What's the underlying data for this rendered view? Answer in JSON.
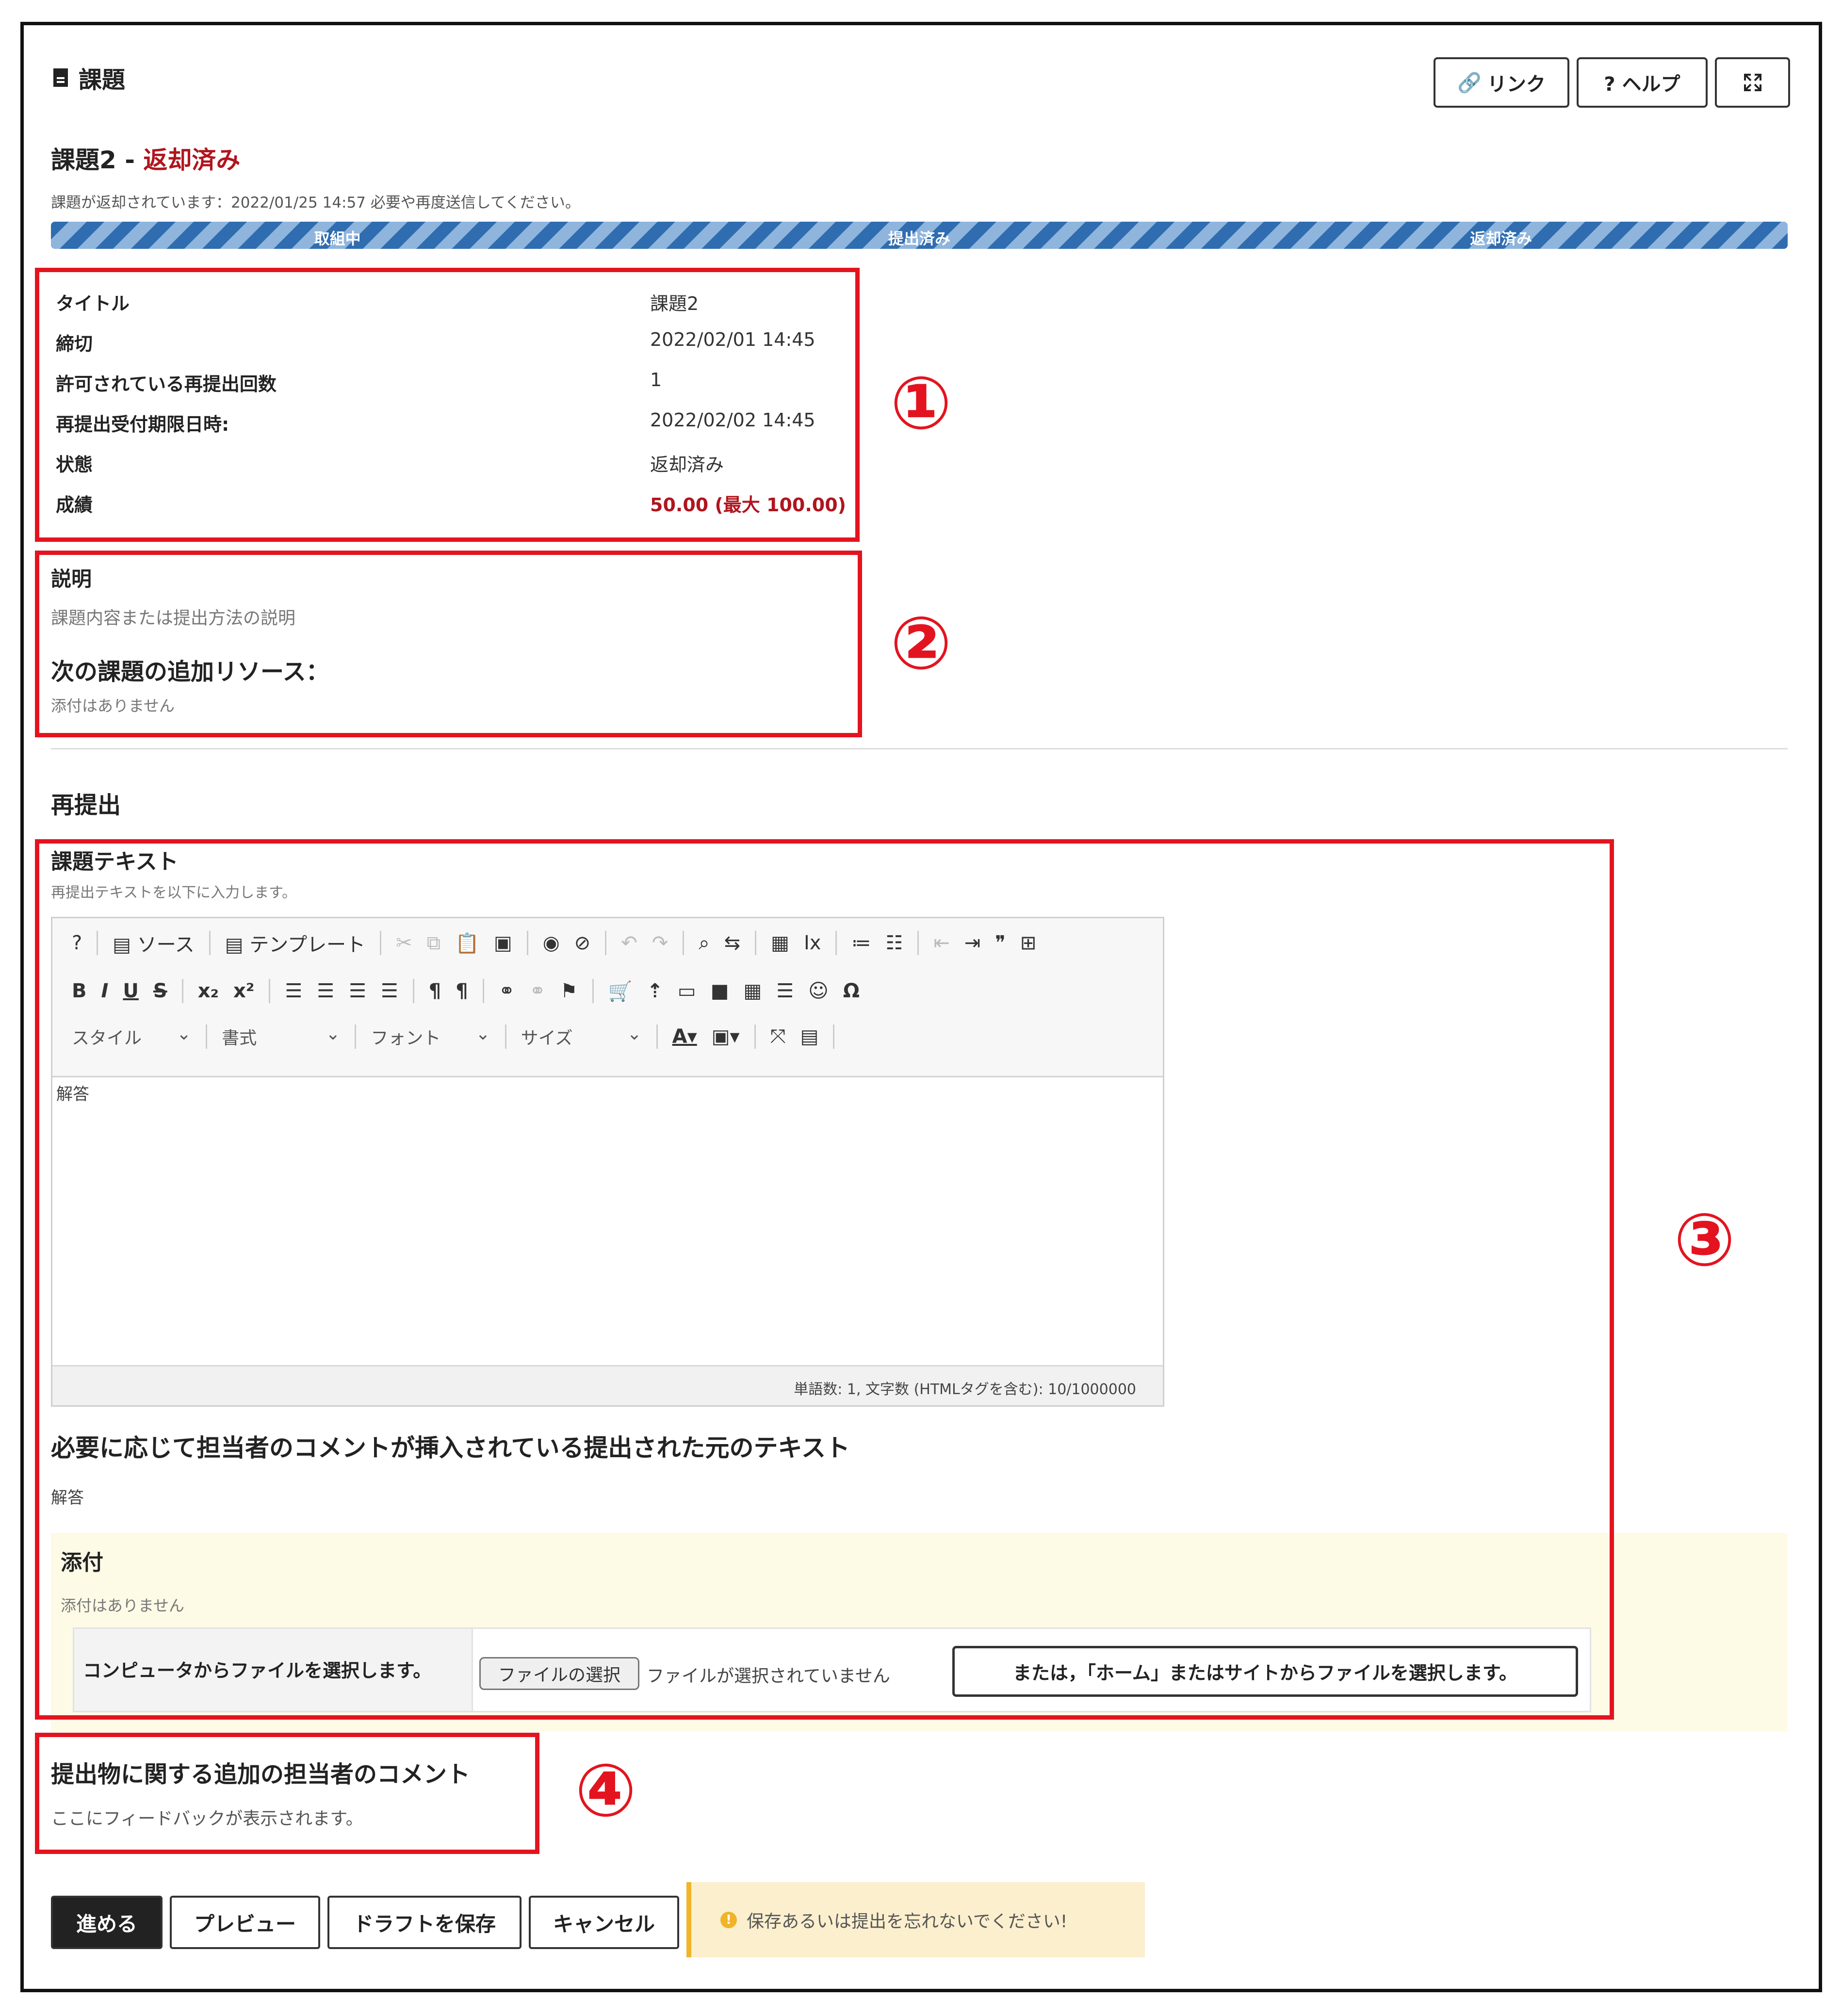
{
  "header": {
    "title": "課題",
    "link_button": "リンク",
    "help_button": "? ヘルプ",
    "fullscreen_icon": "expand-icon"
  },
  "assignment": {
    "name": "課題2",
    "separator": " - ",
    "status_heading": "返却済み",
    "return_notice": "課題が返却されています：2022/01/25 14:57 必要や再度送信してください。",
    "progress_steps": [
      "取組中",
      "提出済み",
      "返却済み"
    ]
  },
  "details": {
    "rows": [
      {
        "label": "タイトル",
        "value": "課題2"
      },
      {
        "label": "締切",
        "value": "2022/02/01 14:45"
      },
      {
        "label": "許可されている再提出回数",
        "value": "1"
      },
      {
        "label": "再提出受付期限日時:",
        "value": "2022/02/02 14:45"
      },
      {
        "label": "状態",
        "value": "返却済み"
      },
      {
        "label": "成績",
        "value": "50.00 (最大 100.00)"
      }
    ]
  },
  "description": {
    "heading": "説明",
    "text": "課題内容または提出方法の説明",
    "resources_heading": "次の課題の追加リソース：",
    "no_attachments": "添付はありません"
  },
  "resubmit": {
    "heading": "再提出",
    "text_heading": "課題テキスト",
    "text_hint": "再提出テキストを以下に入力します。",
    "editor": {
      "source_label": "ソース",
      "template_label": "テンプレート",
      "style_label": "スタイル",
      "format_label": "書式",
      "font_label": "フォント",
      "size_label": "サイズ",
      "content": "解答",
      "status": "単語数: 1, 文字数 (HTMLタグを含む): 10/1000000"
    },
    "original_heading": "必要に応じて担当者のコメントが挿入されている提出された元のテキスト",
    "original_text": "解答",
    "attach_heading": "添付",
    "attach_none": "添付はありません",
    "file_row_label": "コンピュータからファイルを選択します。",
    "file_choose_button": "ファイルの選択",
    "file_none": "ファイルが選択されていません",
    "home_button": "または，「ホーム」またはサイトからファイルを選択します。"
  },
  "feedback": {
    "heading": "提出物に関する追加の担当者のコメント",
    "text": "ここにフィードバックが表示されます。"
  },
  "actions": {
    "proceed": "進める",
    "preview": "プレビュー",
    "save_draft": "ドラフトを保存",
    "cancel": "キャンセル",
    "warning": "保存あるいは提出を忘れないでください!"
  },
  "annotations": [
    "①",
    "②",
    "③",
    "④"
  ],
  "colors": {
    "annotation_red": "#e3141f",
    "status_red": "#b0151e",
    "progress_blue": "#2f6db0",
    "warning_bg": "#fbefce"
  }
}
